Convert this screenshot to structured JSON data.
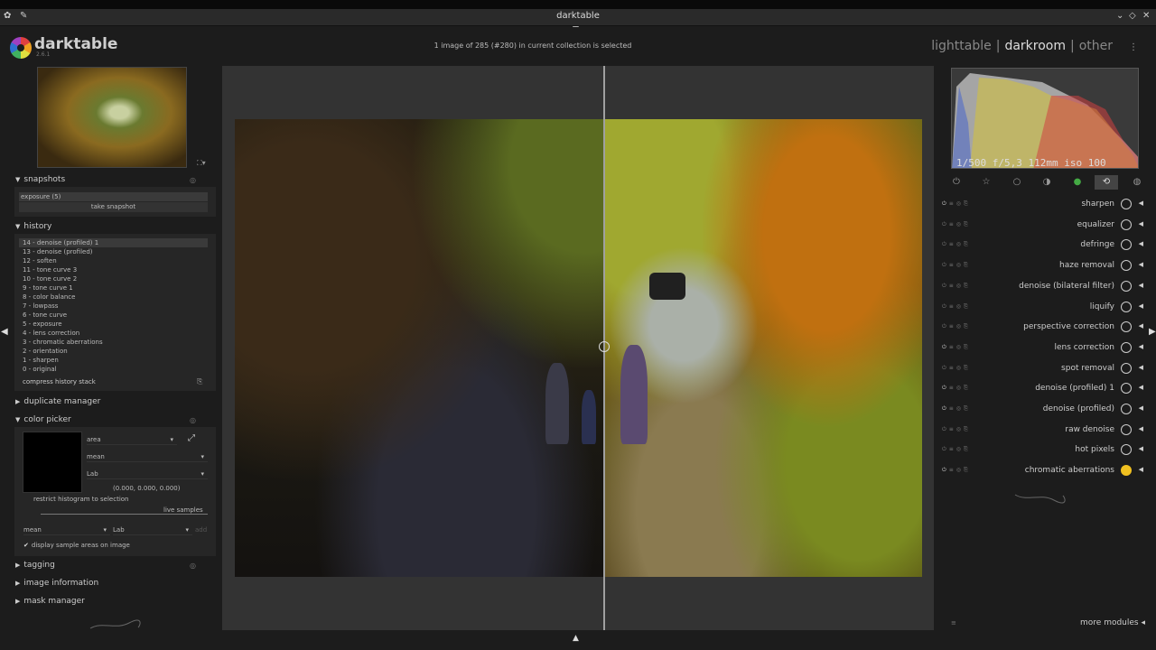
{
  "window": {
    "title": "darktable"
  },
  "header": {
    "logo_text": "darktable",
    "version": "2.6.1",
    "collection_info": "1 image of 285 (#280) in current collection is selected",
    "views": {
      "lighttable": "lighttable",
      "darkroom": "darkroom",
      "other": "other",
      "separator": "|"
    }
  },
  "left": {
    "snapshots": {
      "title": "snapshots",
      "item": "exposure (5)",
      "take": "take snapshot"
    },
    "history": {
      "title": "history",
      "items": [
        "14 - denoise (profiled) 1",
        "13 - denoise (profiled)",
        "12 - soften",
        "11 - tone curve 3",
        "10 - tone curve 2",
        "9 - tone curve 1",
        "8 - color balance",
        "7 - lowpass",
        "6 - tone curve",
        "5 - exposure",
        "4 - lens correction",
        "3 - chromatic aberrations",
        "2 - orientation",
        "1 - sharpen",
        "0 - original"
      ],
      "compress": "compress history stack"
    },
    "duplicate_manager": "duplicate manager",
    "color_picker": {
      "title": "color picker",
      "mode": "area",
      "statistic": "mean",
      "colorspace": "Lab",
      "values": "(0.000, 0.000, 0.000)",
      "restrict": "restrict histogram to selection",
      "live_samples": "live samples",
      "sample_stat": "mean",
      "sample_space": "Lab",
      "add": "add",
      "display_areas": "display sample areas on image"
    },
    "tagging": "tagging",
    "image_information": "image information",
    "mask_manager": "mask manager"
  },
  "right": {
    "exif": "1/500 f/5,3 112mm iso 100",
    "modules": [
      {
        "name": "sharpen",
        "on": true
      },
      {
        "name": "equalizer",
        "on": false
      },
      {
        "name": "defringe",
        "on": false
      },
      {
        "name": "haze removal",
        "on": false
      },
      {
        "name": "denoise (bilateral filter)",
        "on": false
      },
      {
        "name": "liquify",
        "on": false
      },
      {
        "name": "perspective correction",
        "on": false
      },
      {
        "name": "lens correction",
        "on": true
      },
      {
        "name": "spot removal",
        "on": false
      },
      {
        "name": "denoise (profiled) 1",
        "on": true
      },
      {
        "name": "denoise (profiled)",
        "on": true
      },
      {
        "name": "raw denoise",
        "on": false
      },
      {
        "name": "hot pixels",
        "on": false
      },
      {
        "name": "chromatic aberrations",
        "on": true
      }
    ],
    "more_modules": "more modules"
  },
  "colors": {
    "accent_yellow": "#f0c020",
    "background": "#1c1c1c",
    "panel": "#262626",
    "center": "#333333"
  }
}
